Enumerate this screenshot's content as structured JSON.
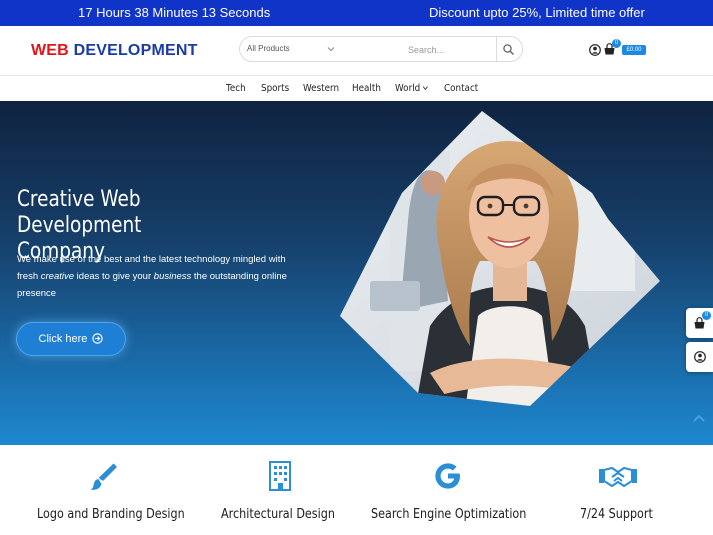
{
  "topbar": {
    "timer": "17 Hours 38 Minutes 13 Seconds",
    "promo": "Discount upto 25%, Limited time offer"
  },
  "header": {
    "logo_word1": "WEB",
    "logo_word2": "DEVELOPMENT",
    "search": {
      "category": "All Products",
      "placeholder": "Search..."
    },
    "cart_count": "0",
    "cart_total": "£0.00"
  },
  "nav": {
    "items": [
      "Tech",
      "Sports",
      "Western",
      "Health",
      "World",
      "Contact"
    ]
  },
  "hero": {
    "title_line1": "Creative Web Development",
    "title_line2": "Company",
    "desc_part1": "We make use of the best and the latest technology mingled with fresh ",
    "desc_em1": "creative",
    "desc_part2": " ideas to give your ",
    "desc_em2": "business",
    "desc_part3": " the outstanding online presence",
    "button_label": "Click here"
  },
  "side": {
    "cart_count": "0"
  },
  "services": [
    {
      "label": "Logo and Branding Design",
      "icon": "paintbrush-icon"
    },
    {
      "label": "Architectural Design",
      "icon": "building-icon"
    },
    {
      "label": "Search Engine Optimization",
      "icon": "google-icon"
    },
    {
      "label": "7/24 Support",
      "icon": "handshake-icon"
    }
  ],
  "colors": {
    "topbar": "#1034c8",
    "logo_red": "#e3141c",
    "logo_blue": "#1b3ba8",
    "accent": "#1e88e5",
    "hero_top": "#0f2340",
    "hero_bottom": "#1e88d0"
  }
}
